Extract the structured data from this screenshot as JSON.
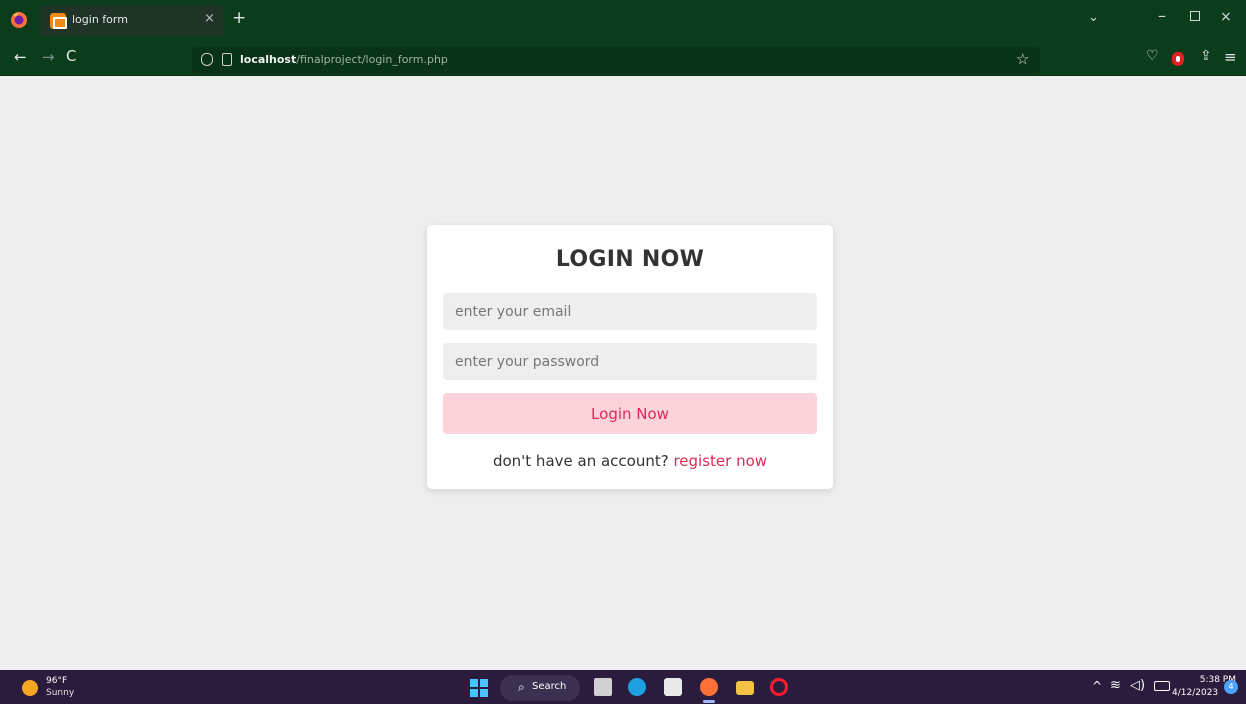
{
  "browser": {
    "tab": {
      "title": "login form",
      "close_glyph": "×",
      "favicon": "xampp-icon"
    },
    "new_tab_glyph": "+",
    "list_tabs_glyph": "⌄",
    "url": {
      "host": "localhost",
      "path": "/finalproject/login_form.php"
    },
    "icons": {
      "back": "←",
      "forward": "→",
      "reload": "C",
      "star": "☆",
      "pocket": "♡",
      "share": "⇪",
      "menu": "≡",
      "minimize": "–",
      "close": "×"
    }
  },
  "form": {
    "title": "LOGIN NOW",
    "email_placeholder": "enter your email",
    "password_placeholder": "enter your password",
    "submit_label": "Login Now",
    "register_prompt": "don't have an account? ",
    "register_link": "register now",
    "accent_color": "#e02a55"
  },
  "taskbar": {
    "weather_temp": "96°F",
    "weather_condition": "Sunny",
    "search_label": "Search",
    "search_glyph": "🔍",
    "time": "5:38 PM",
    "date": "4/12/2023",
    "notification_count": "4",
    "tray_chevron": "^",
    "wifi_glyph": "≋",
    "volume_glyph": "🔊"
  }
}
